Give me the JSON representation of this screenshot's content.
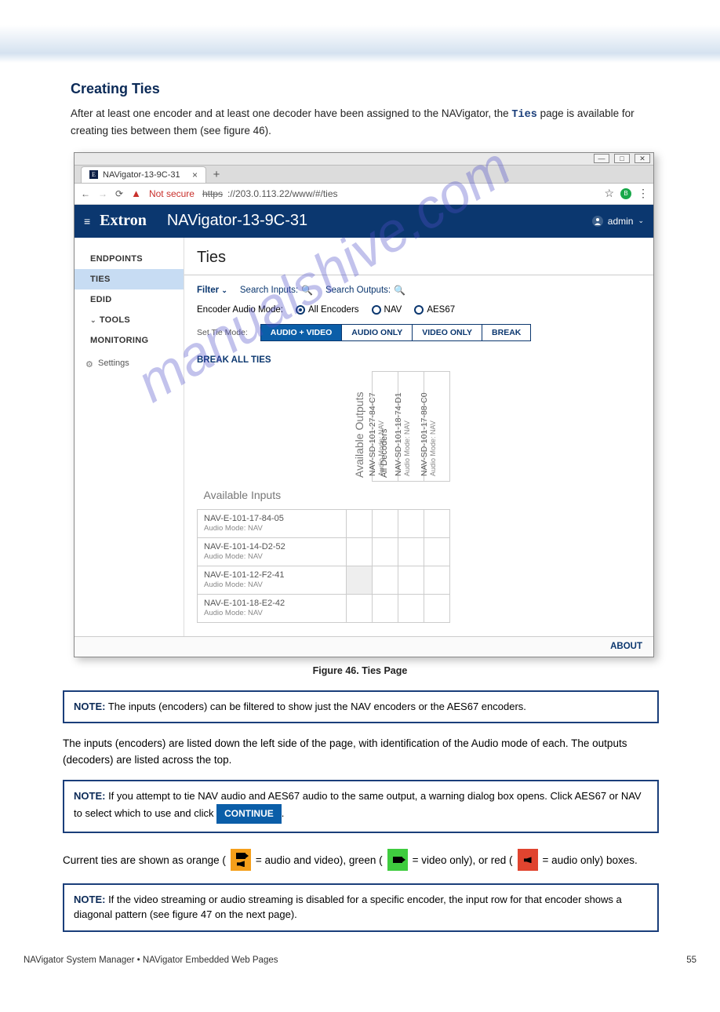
{
  "sectionTitle": "Creating Ties",
  "introText": "After at least one encoder and at least one decoder have been assigned to the NAVigator, the Ties page is available for creating ties between them (see figure 46).",
  "browser": {
    "tabTitle": "NAVigator-13-9C-31",
    "addressPrefix": "https",
    "url": "://203.0.113.22/www/#/ties",
    "notSecure": "Not secure"
  },
  "app": {
    "logo": "Extron",
    "title": "NAVigator-13-9C-31",
    "user": "admin",
    "nav": [
      "ENDPOINTS",
      "TIES",
      "EDID",
      "TOOLS",
      "MONITORING"
    ],
    "settings": "Settings",
    "pageTitle": "Ties",
    "filter": "Filter",
    "searchInputs": "Search Inputs:",
    "searchOutputs": "Search Outputs:",
    "encoderAudioMode": "Encoder Audio Mode:",
    "encoderOptions": [
      "All Encoders",
      "NAV",
      "AES67"
    ],
    "setTieMode": "Set Tie Mode:",
    "segments": [
      "AUDIO + VIDEO",
      "AUDIO ONLY",
      "VIDEO ONLY",
      "BREAK"
    ],
    "breakAll": "BREAK ALL TIES",
    "availableOutputs": "Available Outputs",
    "allDecoders": "All Decoders",
    "availableInputs": "Available Inputs",
    "audioModeLabel": "Audio Mode: NAV",
    "outputs": [
      {
        "name": "NAV-SD-101-27-84-C7"
      },
      {
        "name": "NAV-SD-101-18-74-D1"
      },
      {
        "name": "NAV-SD-101-17-88-C0"
      }
    ],
    "inputs": [
      {
        "name": "NAV-E-101-17-84-05"
      },
      {
        "name": "NAV-E-101-14-D2-52"
      },
      {
        "name": "NAV-E-101-12-F2-41"
      },
      {
        "name": "NAV-E-101-18-E2-42"
      }
    ],
    "about": "ABOUT"
  },
  "figureCaption": "Figure 46.   Ties Page",
  "note1": {
    "label": "NOTE:",
    "text": " The inputs (encoders) can be filtered to show just the NAV encoders or the AES67 encoders."
  },
  "note2": {
    "label": "NOTE:",
    "text": " If you attempt to tie NAV audio and AES67 audio to the same output, a warning dialog box opens. Click AES67 or NAV to select which to use and click ",
    "button": "CONTINUE"
  },
  "noteIntro": "The inputs (encoders) are listed down the left side of the page, with identification of the Audio mode of each. The outputs (decoders) are listed across the top.",
  "colorsText1": "Current ties are shown as orange (",
  "colorsText2": " = audio and video), green (",
  "colorsText3": " = video only), or red (",
  "colorsText4": " = audio only) boxes.",
  "note3": {
    "label": "NOTE:",
    "text": " If the video streaming or audio streaming is disabled for a specific encoder, the input row for that encoder shows a diagonal pattern (see figure 47 on the next page)."
  },
  "footer": {
    "left": "NAVigator System Manager • NAVigator Embedded Web Pages",
    "right": "55"
  }
}
